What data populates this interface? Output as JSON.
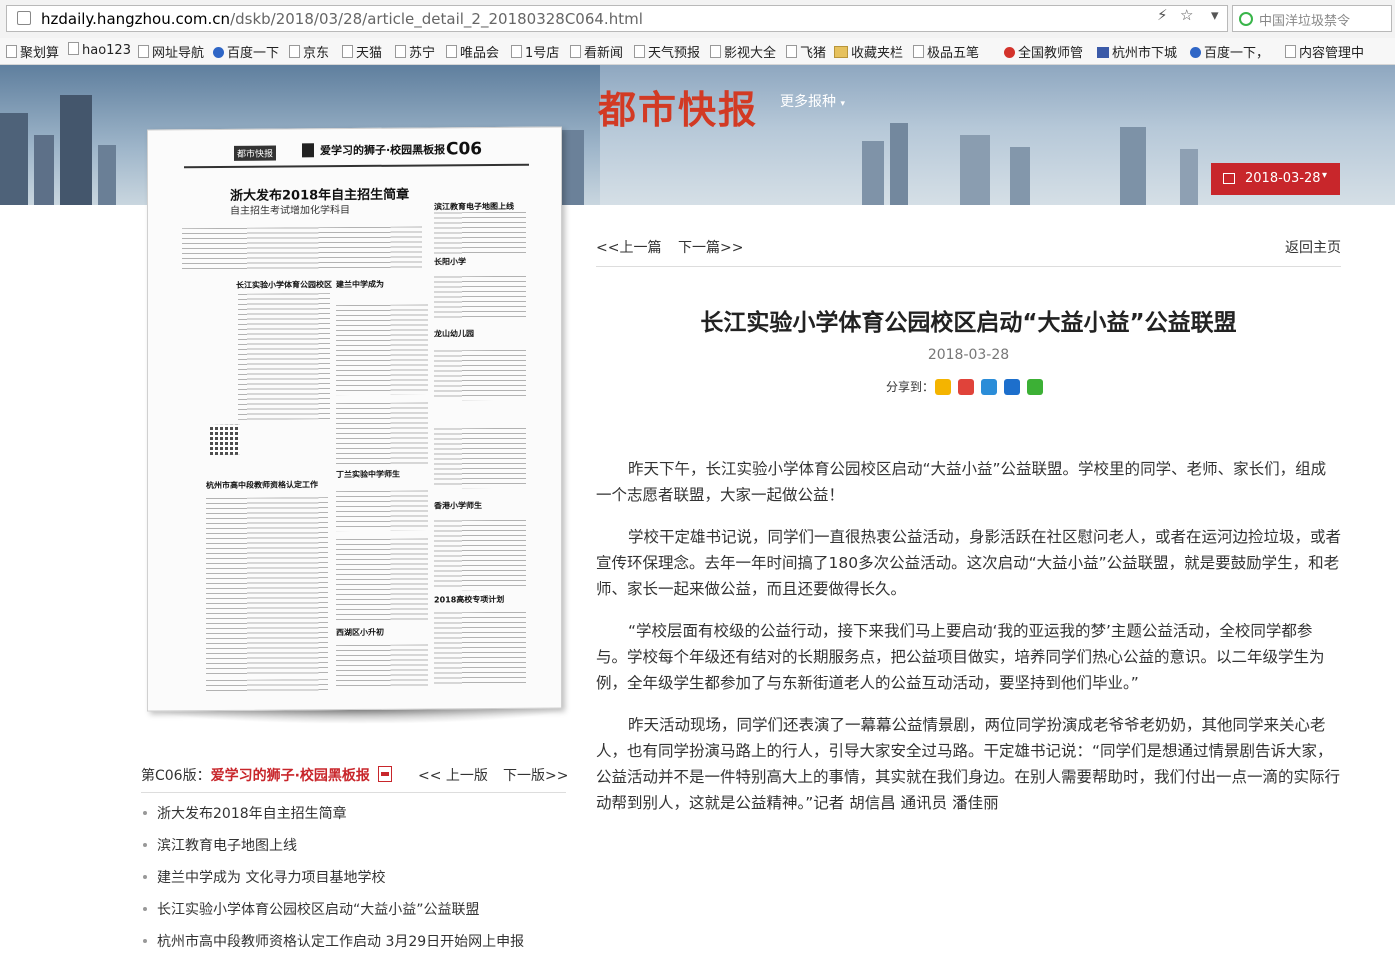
{
  "browser": {
    "url_host": "hzdaily.hangzhou.com.cn",
    "url_path": "/dskb/2018/03/28/article_detail_2_20180328C064.html",
    "search_placeholder": "中国洋垃圾禁令",
    "controls": [
      "⚡",
      "☆",
      "▾"
    ]
  },
  "bookmarks": [
    {
      "label": "聚划算",
      "icon": "page-icon"
    },
    {
      "label": "hao123",
      "icon": "page-icon"
    },
    {
      "label": "网址导航",
      "icon": "page-icon"
    },
    {
      "label": "百度一下",
      "icon": "paw-icon"
    },
    {
      "label": "京东",
      "icon": "page-icon"
    },
    {
      "label": "天猫",
      "icon": "page-icon"
    },
    {
      "label": "苏宁",
      "icon": "page-icon"
    },
    {
      "label": "唯品会",
      "icon": "page-icon"
    },
    {
      "label": "1号店",
      "icon": "page-icon"
    },
    {
      "label": "看新闻",
      "icon": "page-icon"
    },
    {
      "label": "天气预报",
      "icon": "page-icon"
    },
    {
      "label": "影视大全",
      "icon": "page-icon"
    },
    {
      "label": "飞猪",
      "icon": "page-icon"
    },
    {
      "label": "收藏夹栏",
      "icon": "folder-icon"
    },
    {
      "label": "极品五笔",
      "icon": "page-icon"
    },
    {
      "label": "全国教师管",
      "icon": "red-circle-icon"
    },
    {
      "label": "杭州市下城",
      "icon": "news-icon"
    },
    {
      "label": "百度一下，",
      "icon": "paw-icon"
    },
    {
      "label": "内容管理中",
      "icon": "page-icon"
    }
  ],
  "header": {
    "logo": "都市快报",
    "more": "更多报种",
    "more_caret": "▾",
    "date": "2018-03-28",
    "date_caret": "▾"
  },
  "paper": {
    "brand": "都市快报",
    "section_title": "爱学习的狮子·校园黑板报",
    "edition_code": "C06",
    "headline": "浙大发布2018年自主招生简章",
    "subhead": "自主招生考试增加化学科目",
    "right_head": "滨江教育电子地图上线",
    "col_heads": [
      "长江实验小学体育公园校区",
      "建兰中学成为",
      "长阳小学",
      "龙山幼儿园",
      "丁兰实验中学师生",
      "香港小学师生",
      "杭州市高中段教师资格认定工作",
      "西湖区小升初",
      "2018高校专项计划"
    ]
  },
  "edition_bar": {
    "label": "第C06版：",
    "name": "爱学习的狮子·校园黑板报",
    "prev": "<< 上一版",
    "next": "下一版>>"
  },
  "article_list": [
    "浙大发布2018年自主招生简章",
    "滨江教育电子地图上线",
    "建兰中学成为 文化寻力项目基地学校",
    "长江实验小学体育公园校区启动“大益小益”公益联盟",
    "杭州市高中段教师资格认定工作启动 3月29日开始网上申报"
  ],
  "nav": {
    "prev": "<<上一篇",
    "next": "下一篇>>",
    "home": "返回主页"
  },
  "article": {
    "title": "长江实验小学体育公园校区启动“大益小益”公益联盟",
    "date": "2018-03-28",
    "share_label": "分享到：",
    "share_icons": [
      "qzone-icon",
      "weibo-icon",
      "tencent-weibo-icon",
      "renren-icon",
      "wechat-icon"
    ],
    "paragraphs": [
      "昨天下午，长江实验小学体育公园校区启动“大益小益”公益联盟。学校里的同学、老师、家长们，组成一个志愿者联盟，大家一起做公益！",
      "学校干定雄书记说，同学们一直很热衷公益活动，身影活跃在社区慰问老人，或者在运河边捡垃圾，或者宣传环保理念。去年一年时间搞了180多次公益活动。这次启动“大益小益”公益联盟，就是要鼓励学生，和老师、家长一起来做公益，而且还要做得长久。",
      "“学校层面有校级的公益行动，接下来我们马上要启动‘我的亚运我的梦’主题公益活动，全校同学都参与。学校每个年级还有结对的长期服务点，把公益项目做实，培养同学们热心公益的意识。以二年级学生为例，全年级学生都参加了与东新街道老人的公益互动活动，要坚持到他们毕业。”",
      "昨天活动现场，同学们还表演了一幕幕公益情景剧，两位同学扮演成老爷爷老奶奶，其他同学来关心老人，也有同学扮演马路上的行人，引导大家安全过马路。干定雄书记说：“同学们是想通过情景剧告诉大家，公益活动并不是一件特别高大上的事情，其实就在我们身边。在别人需要帮助时，我们付出一点一滴的实际行动帮到别人，这就是公益精神。”记者 胡信昌 通讯员 潘佳丽"
    ]
  },
  "colors": {
    "brand_red": "#c8262b",
    "logo_red": "#d23a24"
  }
}
